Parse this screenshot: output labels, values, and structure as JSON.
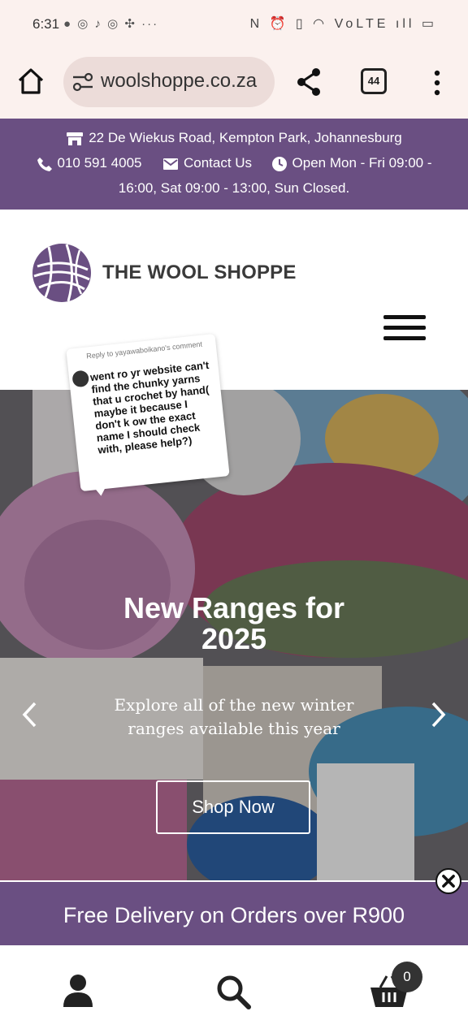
{
  "status_bar": {
    "time": "6:31",
    "left_icons": "● ◎ ♪ ◎ ✣ ···",
    "right_icons": "N ⏰ ▯ ◠ VoLTE ıll ▭"
  },
  "browser": {
    "url": "woolshoppe.co.za",
    "tab_count": "44"
  },
  "topbar": {
    "address": "22 De Wiekus Road, Kempton Park, Johannesburg",
    "phone": "010 591 4005",
    "contact": "Contact Us",
    "hours_line1": "Open Mon - Fri 09:00 -",
    "hours_line2": "16:00, Sat 09:00 - 13:00, Sun Closed."
  },
  "header": {
    "logo_text": "THE WOOL SHOPPE"
  },
  "comment": {
    "reply_to": "Reply to yayawaboikano's comment",
    "text": "went ro yr website can't find the chunky yarns that u crochet by hand( maybe it because I don't k ow the exact name I should check with, please help?)"
  },
  "hero": {
    "title_line1": "New Ranges for",
    "title_line2": "2025",
    "subtitle_line1": "Explore all of the new winter",
    "subtitle_line2": "ranges available this year",
    "button": "Shop Now"
  },
  "promo": {
    "text": "Free Delivery on Orders over R900"
  },
  "bottom_nav": {
    "cart_count": "0"
  },
  "colors": {
    "brand_purple": "#6a4f82",
    "browser_bg": "#fbf1ee"
  },
  "icons": [
    "home-icon",
    "site-settings-icon",
    "share-icon",
    "tabs-icon",
    "more-vert-icon",
    "store-icon",
    "phone-icon",
    "mail-icon",
    "clock-icon",
    "logo-yarn-ball",
    "menu-icon",
    "chevron-left-icon",
    "chevron-right-icon",
    "close-icon",
    "user-icon",
    "search-icon",
    "cart-icon"
  ]
}
